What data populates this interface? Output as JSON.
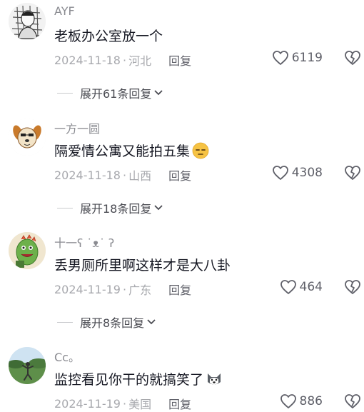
{
  "comments": [
    {
      "username": "AYF",
      "text": "老板办公室放一个",
      "date": "2024-11-18",
      "location": "河北",
      "reply_label": "回复",
      "likes": "6119",
      "avatar": "sketch-portrait",
      "emoji": null,
      "expand": {
        "label": "展开61条回复"
      }
    },
    {
      "username": "一方一圆",
      "text": "隔爱情公寓又能拍五集",
      "date": "2024-11-18",
      "location": "山西",
      "reply_label": "回复",
      "likes": "4308",
      "avatar": "cartoon-dog",
      "emoji": "unamused-face",
      "expand": {
        "label": "展开18条回复"
      }
    },
    {
      "username": "十一ʕ ˙ᴥ˙ ʔ",
      "text": "丢男厕所里啊这样才是大八卦",
      "date": "2024-11-19",
      "location": "广东",
      "reply_label": "回复",
      "likes": "464",
      "avatar": "green-dinosaur",
      "emoji": null,
      "expand": {
        "label": "展开8条回复"
      }
    },
    {
      "username": "Cc。",
      "text": "监控看见你干的就搞笑了",
      "date": "2024-11-19",
      "location": "美国",
      "reply_label": "回复",
      "likes": "886",
      "avatar": "outdoor-photo",
      "emoji": "husky-face",
      "expand": null
    }
  ],
  "colors": {
    "username": "#8a8b91",
    "text": "#161823",
    "meta": "#a7a8ad",
    "action": "#5f6069"
  }
}
